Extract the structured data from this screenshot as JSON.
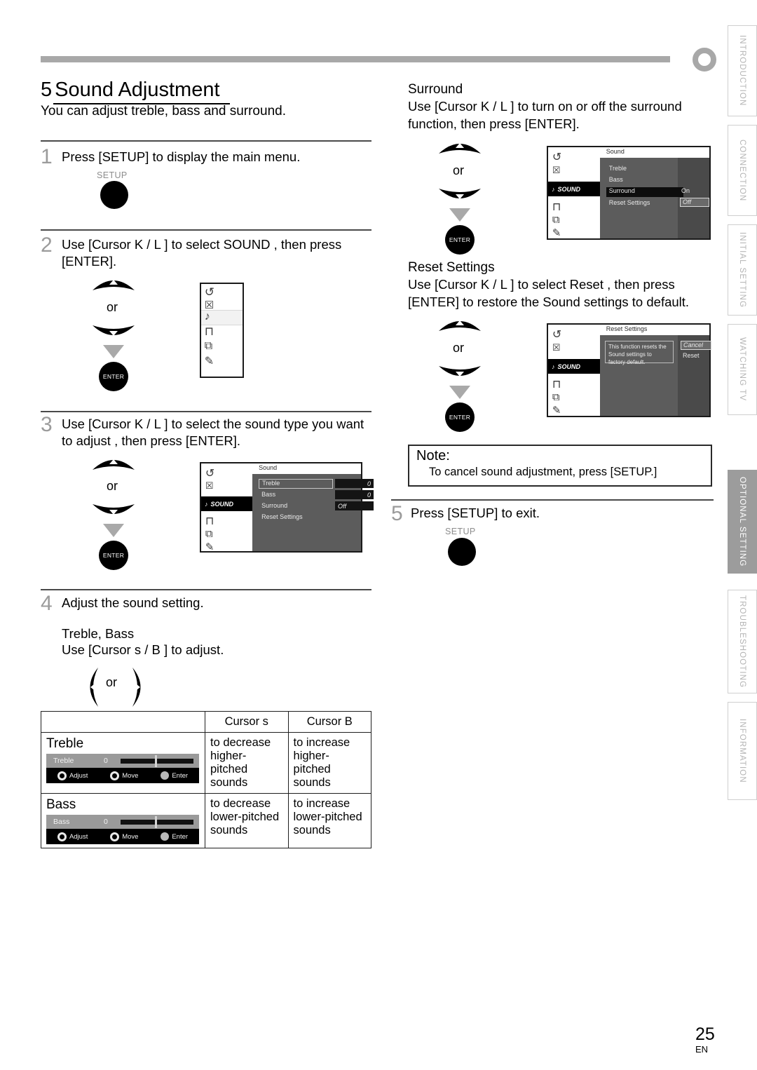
{
  "page": {
    "number": "25",
    "lang": "EN"
  },
  "title": {
    "num": "5",
    "text": "Sound Adjustment"
  },
  "subtitle": "You can adjust treble, bass and surround.",
  "steps": [
    {
      "num": "1",
      "text": "Press [SETUP] to display the main menu.",
      "key_label": "SETUP"
    },
    {
      "num": "2",
      "text": "Use [Cursor K / L ] to select  SOUND , then press [ENTER].",
      "or": "or",
      "enter": "ENTER"
    },
    {
      "num": "3",
      "text": "Use [Cursor K / L ] to select the sound type you want to adjust , then press [ENTER].",
      "or": "or",
      "enter": "ENTER"
    },
    {
      "num": "4",
      "text": "Adjust the sound setting."
    },
    {
      "num": "5",
      "text": "Press [SETUP] to exit.",
      "key_label": "SETUP"
    }
  ],
  "step4": {
    "heading": "Treble, Bass",
    "instruction": "Use [Cursor s / B ] to adjust.",
    "or": "or"
  },
  "cursor_table": {
    "headers": [
      "",
      "Cursor s",
      "Cursor B"
    ],
    "rows": [
      {
        "label": "Treble",
        "osd": {
          "name": "Treble",
          "value": "0",
          "adjust": "Adjust",
          "move": "Move",
          "enter": "Enter"
        },
        "decrease": "to decrease higher-pitched sounds",
        "increase": "to increase higher-pitched sounds"
      },
      {
        "label": "Bass",
        "osd": {
          "name": "Bass",
          "value": "0",
          "adjust": "Adjust",
          "move": "Move",
          "enter": "Enter"
        },
        "decrease": "to decrease lower-pitched sounds",
        "increase": "to increase lower-pitched sounds"
      }
    ]
  },
  "surround_section": {
    "heading": "Surround",
    "body": "Use [Cursor K / L ] to turn on or off the surround function, then press [ENTER].",
    "or": "or",
    "enter": "ENTER"
  },
  "reset_section": {
    "heading": "Reset Settings",
    "body": "Use [Cursor K / L ] to select  Reset , then press [ENTER] to restore the  Sound  settings to default.",
    "or": "or",
    "enter": "ENTER"
  },
  "note": {
    "title": "Note:",
    "body": "To cancel sound adjustment, press [SETUP.]"
  },
  "menu_icons": [
    {
      "name": "return-icon",
      "glyph": "↺"
    },
    {
      "name": "picture-icon",
      "glyph": "☒"
    },
    {
      "name": "sound-icon",
      "glyph": "♪"
    },
    {
      "name": "timer-icon",
      "glyph": "⊓"
    },
    {
      "name": "layers-icon",
      "glyph": "⧉"
    },
    {
      "name": "setup-icon",
      "glyph": "✎"
    }
  ],
  "osd_step2": {
    "selected_icon": "sound-icon"
  },
  "osd_sound": {
    "title": "Sound",
    "sidebar_label": "SOUND",
    "rows": [
      "Treble",
      "Bass",
      "Surround",
      "Reset Settings"
    ],
    "values": [
      "0",
      "0",
      "Off"
    ],
    "highlighted_row": "Treble"
  },
  "osd_surround": {
    "title": "Sound",
    "sidebar_label": "SOUND",
    "rows": [
      "Treble",
      "Bass",
      "Surround",
      "Reset Settings"
    ],
    "selected_row": "Surround",
    "options": [
      "On",
      "Off"
    ],
    "highlighted_option": "Off"
  },
  "osd_reset": {
    "title": "Reset Settings",
    "sidebar_label": "SOUND",
    "message": "This function resets the Sound settings to factory default.",
    "options": [
      "Cancel",
      "Reset"
    ],
    "highlighted_option": "Cancel"
  },
  "tabs": [
    {
      "label": "INTRODUCTION",
      "active": false
    },
    {
      "label": "CONNECTION",
      "active": false
    },
    {
      "label": "INITIAL SETTING",
      "active": false
    },
    {
      "label": "WATCHING TV",
      "active": false
    },
    {
      "label": "OPTIONAL SETTING",
      "active": true
    },
    {
      "label": "TROUBLESHOOTING",
      "active": false
    },
    {
      "label": "INFORMATION",
      "active": false
    }
  ],
  "colors": {
    "accent_gray": "#a8a8a8",
    "osd_body": "#5c5c5c",
    "osd_select": "#0d0d0d"
  }
}
